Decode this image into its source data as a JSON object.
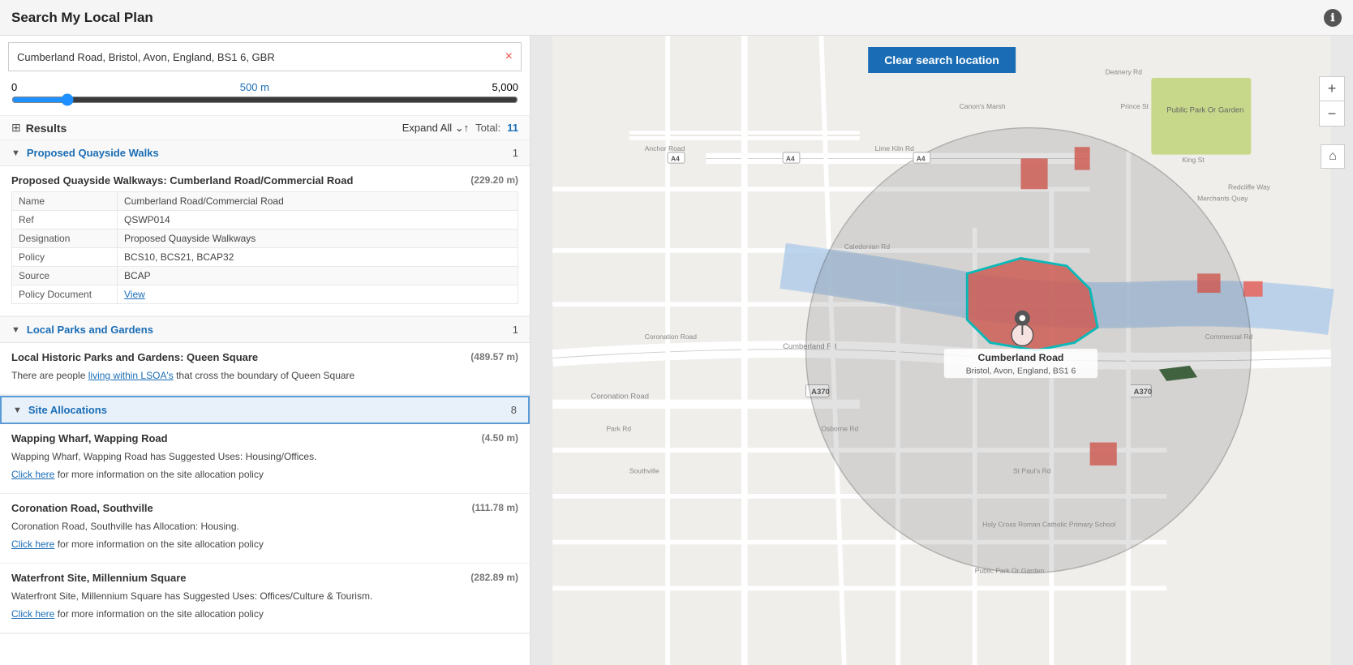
{
  "header": {
    "title": "Search My Local Plan",
    "info_icon": "ℹ"
  },
  "search": {
    "value": "Cumberland Road, Bristol, Avon, England, BS1 6, GBR",
    "clear_label": "×"
  },
  "slider": {
    "min": 0,
    "max": 5000,
    "value": 500,
    "label": "500 m",
    "min_label": "0",
    "max_label": "5,000"
  },
  "results": {
    "label": "Results",
    "expand_all": "Expand All",
    "total_label": "Total:",
    "total": "11"
  },
  "sections": [
    {
      "id": "proposed-quayside-walks",
      "title": "Proposed Quayside Walks",
      "count": "1",
      "expanded": true,
      "highlighted": false,
      "items": [
        {
          "title": "Proposed Quayside Walkways: Cumberland Road/Commercial Road",
          "distance": "(229.20 m)",
          "properties": [
            {
              "key": "Name",
              "value": "Cumberland Road/Commercial Road",
              "is_link": false
            },
            {
              "key": "Ref",
              "value": "QSWP014",
              "is_link": false
            },
            {
              "key": "Designation",
              "value": "Proposed Quayside Walkways",
              "is_link": false
            },
            {
              "key": "Policy",
              "value": "BCS10, BCS21, BCAP32",
              "is_link": false
            },
            {
              "key": "Source",
              "value": "BCAP",
              "is_link": false
            },
            {
              "key": "Policy Document",
              "value": "View",
              "is_link": true
            }
          ]
        }
      ]
    },
    {
      "id": "local-parks-gardens",
      "title": "Local Parks and Gardens",
      "count": "1",
      "expanded": true,
      "highlighted": false,
      "items": [
        {
          "title": "Local Historic Parks and Gardens: Queen Square",
          "distance": "(489.57 m)",
          "desc_parts": [
            {
              "text": "There are people ",
              "link": false
            },
            {
              "text": "living within LSOA's",
              "link": true
            },
            {
              "text": " that cross the boundary of Queen Square",
              "link": false
            }
          ]
        }
      ]
    },
    {
      "id": "site-allocations",
      "title": "Site Allocations",
      "count": "8",
      "expanded": true,
      "highlighted": true,
      "items": [
        {
          "title": "Wapping Wharf, Wapping Road",
          "distance": "(4.50 m)",
          "desc": "Wapping Wharf, Wapping Road has Suggested Uses: Housing/Offices.",
          "link_text": "Click here",
          "link_suffix": " for more information on the site allocation policy"
        },
        {
          "title": "Coronation Road, Southville",
          "distance": "(111.78 m)",
          "desc": "Coronation Road, Southville has Allocation: Housing.",
          "link_text": "Click here",
          "link_suffix": " for more information on the site allocation policy"
        },
        {
          "title": "Waterfront Site, Millennium Square",
          "distance": "(282.89 m)",
          "desc": "Waterfront Site, Millennium Square has Suggested Uses: Offices/Culture & Tourism.",
          "link_text": "Click here",
          "link_suffix": " for more information on the site allocation policy"
        }
      ]
    }
  ],
  "map": {
    "clear_button": "Clear search location",
    "location_label": "Cumberland Road",
    "location_sublabel": "Bristol, Avon, England, BS1 6",
    "zoom_in": "+",
    "zoom_out": "−",
    "home": "⌂"
  }
}
